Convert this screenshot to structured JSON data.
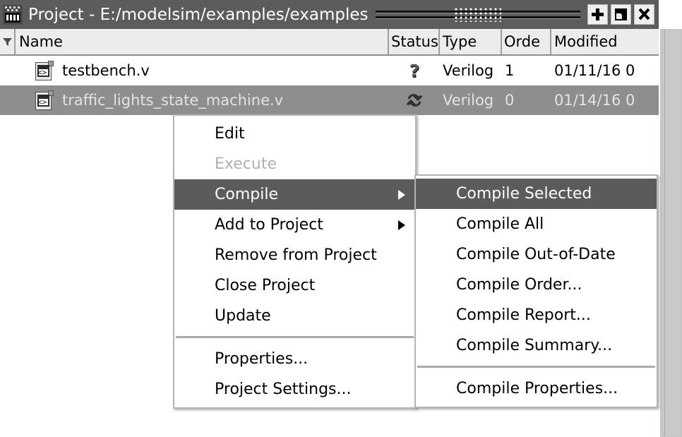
{
  "window": {
    "title": "Project - E:/modelsim/examples/examples",
    "icon": "modelsim-app-icon",
    "buttons": [
      {
        "name": "dock-button",
        "icon": "plus-icon",
        "label": "+"
      },
      {
        "name": "undock-button",
        "icon": "restore-icon",
        "label": "↗"
      },
      {
        "name": "close-button",
        "icon": "close-icon",
        "label": "✕"
      }
    ],
    "grip": "window-drag-grip"
  },
  "colors": {
    "titlebar_bg": "#5c5c5c",
    "header_bg": "#ececec",
    "selection_bg": "#8e8e8e",
    "menu_highlight_bg": "#5b5b5b",
    "menu_bg": "#ffffff",
    "menu_border": "#b4b4b4",
    "disabled_text": "#b0b0b0",
    "scrollbar_bg": "#c6c6c6"
  },
  "table": {
    "filter_icon": "funnel-filter-icon",
    "columns": [
      {
        "key": "name",
        "label": "Name"
      },
      {
        "key": "status",
        "label": "Status"
      },
      {
        "key": "type",
        "label": "Type"
      },
      {
        "key": "order",
        "label": "Orde"
      },
      {
        "key": "modified",
        "label": "Modified"
      }
    ],
    "rows": [
      {
        "name": "testbench.v",
        "icon": "verilog-file-icon",
        "status_icon": "question-mark-status-icon",
        "type": "Verilog",
        "order": "1",
        "modified": "01/11/16 0",
        "selected": false
      },
      {
        "name": "traffic_lights_state_machine.v",
        "icon": "verilog-file-icon",
        "status_icon": "recompile-status-icon",
        "type": "Verilog",
        "order": "0",
        "modified": "01/14/16 0",
        "selected": true
      }
    ]
  },
  "context_menu": {
    "items": [
      {
        "label": "Edit",
        "state": "normal",
        "submenu": false
      },
      {
        "label": "Execute",
        "state": "disabled",
        "submenu": false
      },
      {
        "label": "Compile",
        "state": "highlight",
        "submenu": true
      },
      {
        "label": "Add to Project",
        "state": "normal",
        "submenu": true
      },
      {
        "label": "Remove from Project",
        "state": "normal",
        "submenu": false
      },
      {
        "label": "Close Project",
        "state": "normal",
        "submenu": false
      },
      {
        "label": "Update",
        "state": "normal",
        "submenu": false
      },
      {
        "label": "",
        "state": "separator",
        "submenu": false
      },
      {
        "label": "Properties...",
        "state": "normal",
        "submenu": false
      },
      {
        "label": "Project Settings...",
        "state": "normal",
        "submenu": false
      }
    ]
  },
  "submenu": {
    "parent": "Compile",
    "items": [
      {
        "label": "Compile Selected",
        "state": "highlight"
      },
      {
        "label": "Compile All",
        "state": "normal"
      },
      {
        "label": "Compile Out-of-Date",
        "state": "normal"
      },
      {
        "label": "Compile Order...",
        "state": "normal"
      },
      {
        "label": "Compile Report...",
        "state": "normal"
      },
      {
        "label": "Compile Summary...",
        "state": "normal"
      },
      {
        "label": "",
        "state": "separator"
      },
      {
        "label": "Compile Properties...",
        "state": "normal"
      }
    ]
  }
}
